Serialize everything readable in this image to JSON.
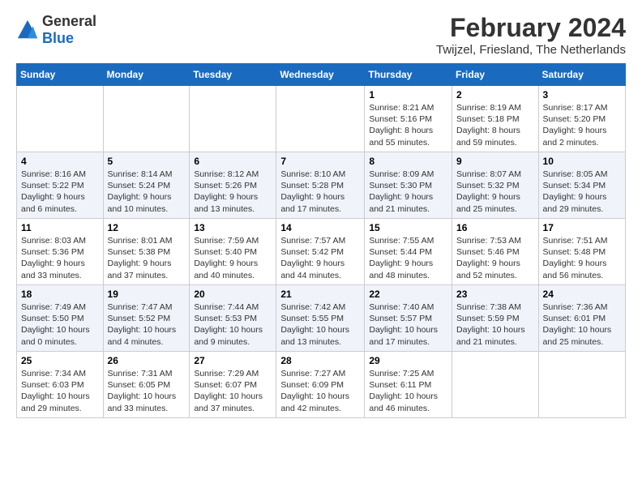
{
  "logo": {
    "general": "General",
    "blue": "Blue"
  },
  "title": "February 2024",
  "subtitle": "Twijzel, Friesland, The Netherlands",
  "days_of_week": [
    "Sunday",
    "Monday",
    "Tuesday",
    "Wednesday",
    "Thursday",
    "Friday",
    "Saturday"
  ],
  "weeks": [
    [
      {
        "day": "",
        "sunrise": "",
        "sunset": "",
        "daylight": ""
      },
      {
        "day": "",
        "sunrise": "",
        "sunset": "",
        "daylight": ""
      },
      {
        "day": "",
        "sunrise": "",
        "sunset": "",
        "daylight": ""
      },
      {
        "day": "",
        "sunrise": "",
        "sunset": "",
        "daylight": ""
      },
      {
        "day": "1",
        "sunrise": "Sunrise: 8:21 AM",
        "sunset": "Sunset: 5:16 PM",
        "daylight": "Daylight: 8 hours and 55 minutes."
      },
      {
        "day": "2",
        "sunrise": "Sunrise: 8:19 AM",
        "sunset": "Sunset: 5:18 PM",
        "daylight": "Daylight: 8 hours and 59 minutes."
      },
      {
        "day": "3",
        "sunrise": "Sunrise: 8:17 AM",
        "sunset": "Sunset: 5:20 PM",
        "daylight": "Daylight: 9 hours and 2 minutes."
      }
    ],
    [
      {
        "day": "4",
        "sunrise": "Sunrise: 8:16 AM",
        "sunset": "Sunset: 5:22 PM",
        "daylight": "Daylight: 9 hours and 6 minutes."
      },
      {
        "day": "5",
        "sunrise": "Sunrise: 8:14 AM",
        "sunset": "Sunset: 5:24 PM",
        "daylight": "Daylight: 9 hours and 10 minutes."
      },
      {
        "day": "6",
        "sunrise": "Sunrise: 8:12 AM",
        "sunset": "Sunset: 5:26 PM",
        "daylight": "Daylight: 9 hours and 13 minutes."
      },
      {
        "day": "7",
        "sunrise": "Sunrise: 8:10 AM",
        "sunset": "Sunset: 5:28 PM",
        "daylight": "Daylight: 9 hours and 17 minutes."
      },
      {
        "day": "8",
        "sunrise": "Sunrise: 8:09 AM",
        "sunset": "Sunset: 5:30 PM",
        "daylight": "Daylight: 9 hours and 21 minutes."
      },
      {
        "day": "9",
        "sunrise": "Sunrise: 8:07 AM",
        "sunset": "Sunset: 5:32 PM",
        "daylight": "Daylight: 9 hours and 25 minutes."
      },
      {
        "day": "10",
        "sunrise": "Sunrise: 8:05 AM",
        "sunset": "Sunset: 5:34 PM",
        "daylight": "Daylight: 9 hours and 29 minutes."
      }
    ],
    [
      {
        "day": "11",
        "sunrise": "Sunrise: 8:03 AM",
        "sunset": "Sunset: 5:36 PM",
        "daylight": "Daylight: 9 hours and 33 minutes."
      },
      {
        "day": "12",
        "sunrise": "Sunrise: 8:01 AM",
        "sunset": "Sunset: 5:38 PM",
        "daylight": "Daylight: 9 hours and 37 minutes."
      },
      {
        "day": "13",
        "sunrise": "Sunrise: 7:59 AM",
        "sunset": "Sunset: 5:40 PM",
        "daylight": "Daylight: 9 hours and 40 minutes."
      },
      {
        "day": "14",
        "sunrise": "Sunrise: 7:57 AM",
        "sunset": "Sunset: 5:42 PM",
        "daylight": "Daylight: 9 hours and 44 minutes."
      },
      {
        "day": "15",
        "sunrise": "Sunrise: 7:55 AM",
        "sunset": "Sunset: 5:44 PM",
        "daylight": "Daylight: 9 hours and 48 minutes."
      },
      {
        "day": "16",
        "sunrise": "Sunrise: 7:53 AM",
        "sunset": "Sunset: 5:46 PM",
        "daylight": "Daylight: 9 hours and 52 minutes."
      },
      {
        "day": "17",
        "sunrise": "Sunrise: 7:51 AM",
        "sunset": "Sunset: 5:48 PM",
        "daylight": "Daylight: 9 hours and 56 minutes."
      }
    ],
    [
      {
        "day": "18",
        "sunrise": "Sunrise: 7:49 AM",
        "sunset": "Sunset: 5:50 PM",
        "daylight": "Daylight: 10 hours and 0 minutes."
      },
      {
        "day": "19",
        "sunrise": "Sunrise: 7:47 AM",
        "sunset": "Sunset: 5:52 PM",
        "daylight": "Daylight: 10 hours and 4 minutes."
      },
      {
        "day": "20",
        "sunrise": "Sunrise: 7:44 AM",
        "sunset": "Sunset: 5:53 PM",
        "daylight": "Daylight: 10 hours and 9 minutes."
      },
      {
        "day": "21",
        "sunrise": "Sunrise: 7:42 AM",
        "sunset": "Sunset: 5:55 PM",
        "daylight": "Daylight: 10 hours and 13 minutes."
      },
      {
        "day": "22",
        "sunrise": "Sunrise: 7:40 AM",
        "sunset": "Sunset: 5:57 PM",
        "daylight": "Daylight: 10 hours and 17 minutes."
      },
      {
        "day": "23",
        "sunrise": "Sunrise: 7:38 AM",
        "sunset": "Sunset: 5:59 PM",
        "daylight": "Daylight: 10 hours and 21 minutes."
      },
      {
        "day": "24",
        "sunrise": "Sunrise: 7:36 AM",
        "sunset": "Sunset: 6:01 PM",
        "daylight": "Daylight: 10 hours and 25 minutes."
      }
    ],
    [
      {
        "day": "25",
        "sunrise": "Sunrise: 7:34 AM",
        "sunset": "Sunset: 6:03 PM",
        "daylight": "Daylight: 10 hours and 29 minutes."
      },
      {
        "day": "26",
        "sunrise": "Sunrise: 7:31 AM",
        "sunset": "Sunset: 6:05 PM",
        "daylight": "Daylight: 10 hours and 33 minutes."
      },
      {
        "day": "27",
        "sunrise": "Sunrise: 7:29 AM",
        "sunset": "Sunset: 6:07 PM",
        "daylight": "Daylight: 10 hours and 37 minutes."
      },
      {
        "day": "28",
        "sunrise": "Sunrise: 7:27 AM",
        "sunset": "Sunset: 6:09 PM",
        "daylight": "Daylight: 10 hours and 42 minutes."
      },
      {
        "day": "29",
        "sunrise": "Sunrise: 7:25 AM",
        "sunset": "Sunset: 6:11 PM",
        "daylight": "Daylight: 10 hours and 46 minutes."
      },
      {
        "day": "",
        "sunrise": "",
        "sunset": "",
        "daylight": ""
      },
      {
        "day": "",
        "sunrise": "",
        "sunset": "",
        "daylight": ""
      }
    ]
  ]
}
